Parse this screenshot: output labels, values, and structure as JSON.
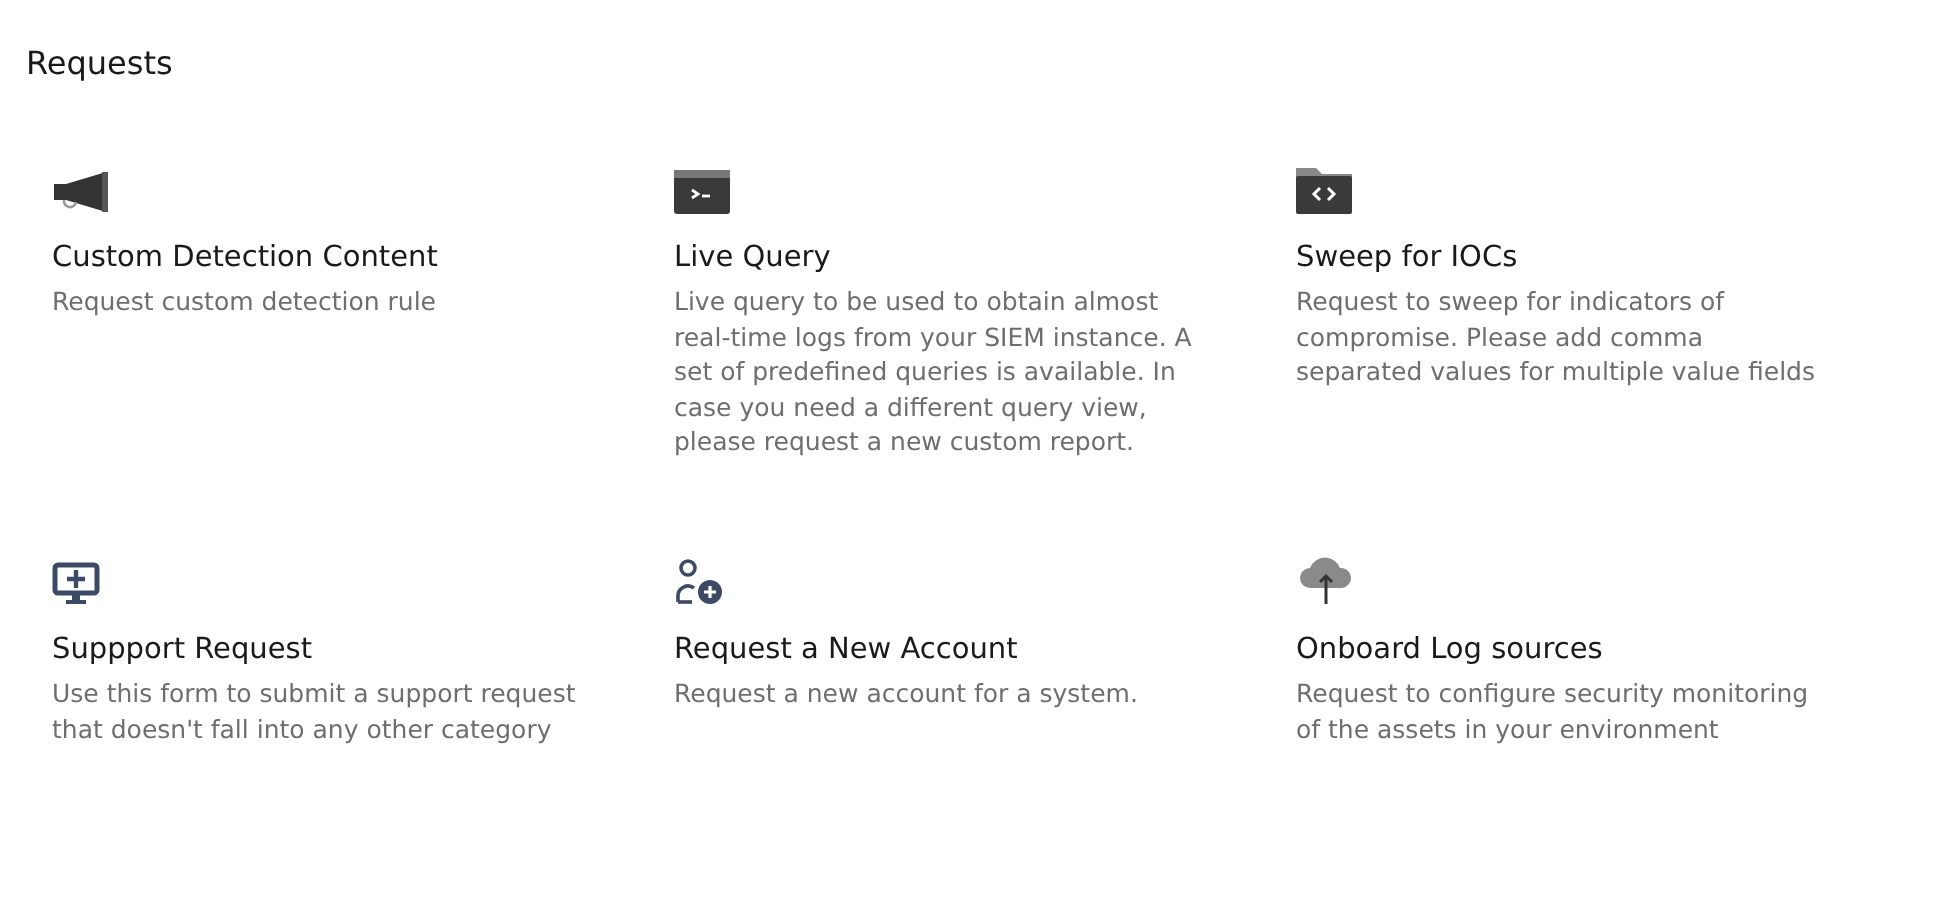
{
  "page_title": "Requests",
  "cards": [
    {
      "title": "Custom Detection Content",
      "description": "Request custom detection rule"
    },
    {
      "title": "Live Query",
      "description": "Live query to be used to obtain almost real-time logs from your SIEM instance. A set of predefined queries is available. In case you need a different query view, please request a new custom report."
    },
    {
      "title": "Sweep for IOCs",
      "description": "Request to sweep for indicators of compromise. Please add comma separated values for multiple value fields"
    },
    {
      "title": "Suppport Request",
      "description": "Use this form to submit a support request that doesn't fall into any other category"
    },
    {
      "title": "Request a New Account",
      "description": "Request a new account for a system."
    },
    {
      "title": "Onboard Log sources",
      "description": "Request to configure security monitoring of the assets in your environment"
    }
  ]
}
